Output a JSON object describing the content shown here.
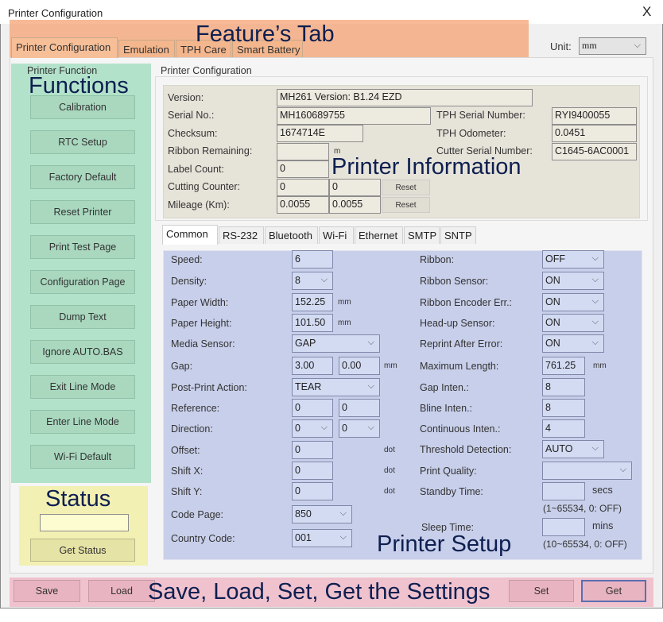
{
  "window": {
    "title": "Printer Configuration",
    "close": "X"
  },
  "tabs": [
    "Printer Configuration",
    "Emulation",
    "TPH Care",
    "Smart Battery"
  ],
  "unit": {
    "label": "Unit:",
    "value": "mm"
  },
  "annotations": {
    "feature": "Feature’s Tab",
    "functions": "Functions",
    "status": "Status",
    "info": "Printer Information",
    "setup": "Printer Setup",
    "bottom": "Save, Load, Set, Get the Settings"
  },
  "functions": {
    "group": "Printer Function",
    "buttons": [
      "Calibration",
      "RTC Setup",
      "Factory Default",
      "Reset Printer",
      "Print Test Page",
      "Configuration Page",
      "Dump Text",
      "Ignore AUTO.BAS",
      "Exit Line Mode",
      "Enter Line Mode",
      "Wi-Fi Default"
    ]
  },
  "status": {
    "value": "",
    "button": "Get Status"
  },
  "info": {
    "group": "Printer Configuration",
    "version": {
      "label": "Version:",
      "value": "MH261 Version: B1.24 EZD"
    },
    "serial": {
      "label": "Serial No.:",
      "value": "MH160689755"
    },
    "checksum": {
      "label": "Checksum:",
      "value": "1674714E"
    },
    "ribbon_remaining": {
      "label": "Ribbon Remaining:",
      "value": "",
      "unit": "m"
    },
    "label_count": {
      "label": "Label Count:",
      "value": "0"
    },
    "cutting_counter": {
      "label": "Cutting Counter:",
      "value1": "0",
      "value2": "0",
      "reset": "Reset"
    },
    "mileage": {
      "label": "Mileage (Km):",
      "value1": "0.0055",
      "value2": "0.0055",
      "reset": "Reset"
    },
    "tph_serial": {
      "label": "TPH Serial Number:",
      "value": "RYI9400055"
    },
    "tph_odometer": {
      "label": "TPH Odometer:",
      "value": "0.0451"
    },
    "cutter_serial": {
      "label": "Cutter Serial Number:",
      "value": "C1645-6AC0001"
    }
  },
  "setup": {
    "tabs": [
      "Common",
      "RS-232",
      "Bluetooth",
      "Wi-Fi",
      "Ethernet",
      "SMTP",
      "SNTP"
    ],
    "left": [
      {
        "label": "Speed:",
        "kind": "input",
        "values": [
          "6"
        ]
      },
      {
        "label": "Density:",
        "kind": "select",
        "values": [
          "8"
        ]
      },
      {
        "label": "Paper Width:",
        "kind": "input",
        "values": [
          "152.25"
        ],
        "unit": "mm"
      },
      {
        "label": "Paper Height:",
        "kind": "input",
        "values": [
          "101.50"
        ],
        "unit": "mm"
      },
      {
        "label": "Media Sensor:",
        "kind": "select",
        "values": [
          "GAP"
        ]
      },
      {
        "label": "Gap:",
        "kind": "input",
        "values": [
          "3.00",
          "0.00"
        ],
        "unit": "mm"
      },
      {
        "label": "Post-Print Action:",
        "kind": "select",
        "values": [
          "TEAR"
        ]
      },
      {
        "label": "Reference:",
        "kind": "input",
        "values": [
          "0",
          "0"
        ]
      },
      {
        "label": "Direction:",
        "kind": "select",
        "values": [
          "0",
          "0"
        ]
      },
      {
        "label": "Offset:",
        "kind": "input",
        "values": [
          "0"
        ],
        "unit": "dot"
      },
      {
        "label": "Shift X:",
        "kind": "input",
        "values": [
          "0"
        ],
        "unit": "dot"
      },
      {
        "label": "Shift Y:",
        "kind": "input",
        "values": [
          "0"
        ],
        "unit": "dot"
      },
      {
        "label": "Code Page:",
        "kind": "select",
        "values": [
          "850"
        ]
      },
      {
        "label": "Country Code:",
        "kind": "select",
        "values": [
          "001"
        ]
      }
    ],
    "right": [
      {
        "label": "Ribbon:",
        "kind": "select",
        "values": [
          "OFF"
        ]
      },
      {
        "label": "Ribbon Sensor:",
        "kind": "select",
        "values": [
          "ON"
        ]
      },
      {
        "label": "Ribbon Encoder Err.:",
        "kind": "select",
        "values": [
          "ON"
        ]
      },
      {
        "label": "Head-up Sensor:",
        "kind": "select",
        "values": [
          "ON"
        ]
      },
      {
        "label": "Reprint After Error:",
        "kind": "select",
        "values": [
          "ON"
        ]
      },
      {
        "label": "Maximum Length:",
        "kind": "input",
        "values": [
          "761.25"
        ],
        "unit": "mm"
      },
      {
        "label": "Gap Inten.:",
        "kind": "input",
        "values": [
          "8"
        ]
      },
      {
        "label": "Bline Inten.:",
        "kind": "input",
        "values": [
          "8"
        ]
      },
      {
        "label": "Continuous Inten.:",
        "kind": "input",
        "values": [
          "4"
        ]
      },
      {
        "label": "Threshold Detection:",
        "kind": "select",
        "values": [
          "AUTO"
        ]
      },
      {
        "label": "Print Quality:",
        "kind": "select",
        "values": [
          ""
        ]
      },
      {
        "label": "Standby Time:",
        "kind": "input",
        "values": [
          ""
        ],
        "unit": "secs",
        "note": "(1~65534, 0: OFF)"
      },
      {
        "label": "Sleep Time:",
        "kind": "input",
        "values": [
          ""
        ],
        "unit": "mins",
        "note": "(10~65534, 0: OFF)"
      }
    ]
  },
  "footer": {
    "save": "Save",
    "load": "Load",
    "set": "Set",
    "get": "Get"
  },
  "colors": {
    "feature_overlay": "#f5a06e",
    "functions_overlay": "#b3e2cb",
    "status_overlay": "#f3f0b3",
    "setup_overlay": "#c8cfea",
    "footer_overlay": "#f0c2ce",
    "annotation_text": "#0e1f50"
  }
}
